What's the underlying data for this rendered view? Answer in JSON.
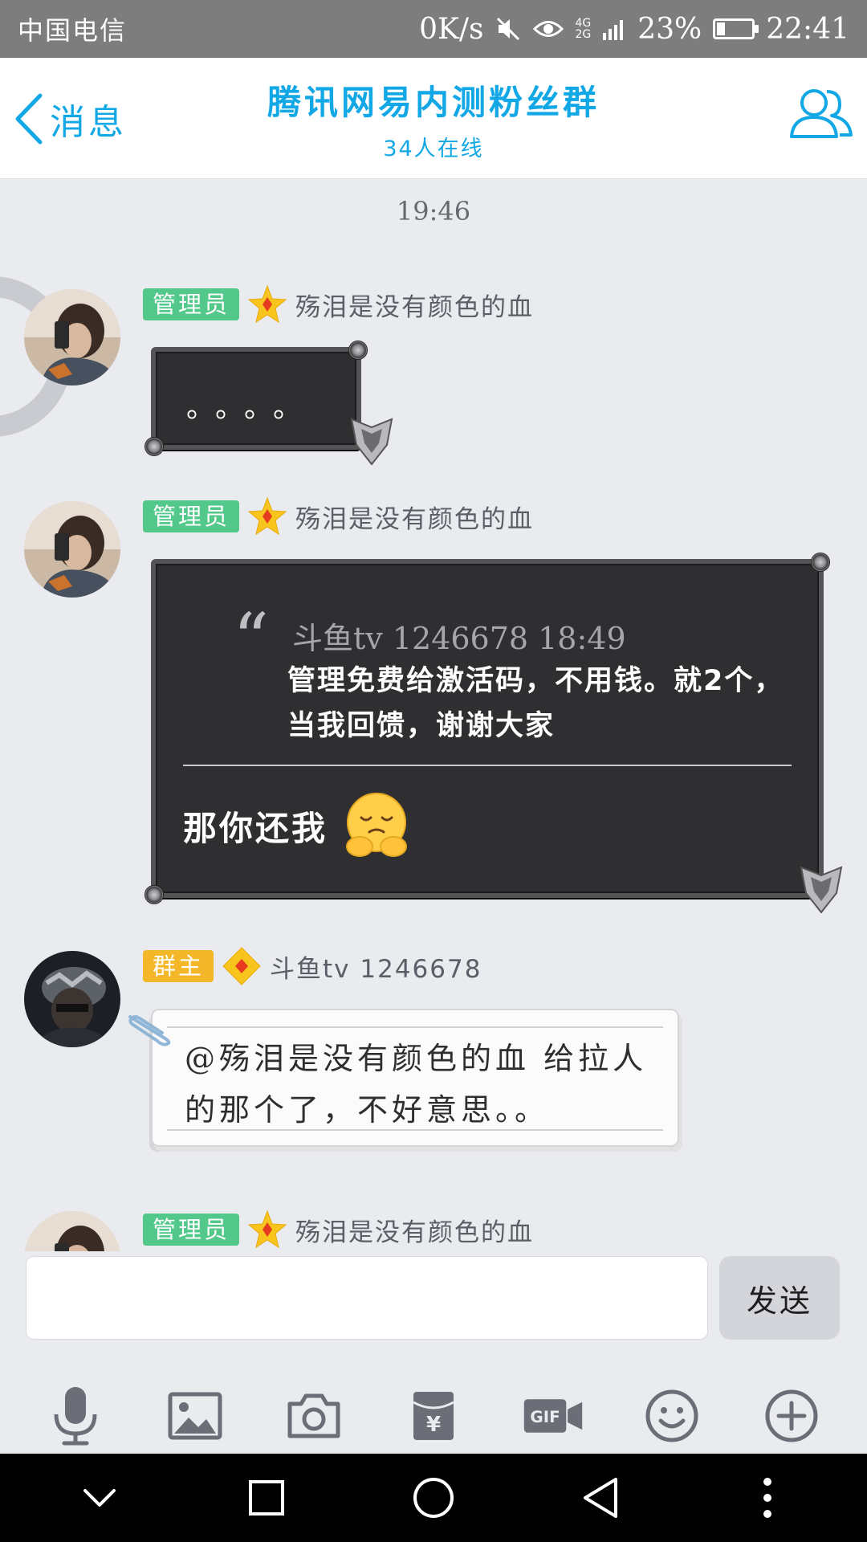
{
  "status_bar": {
    "carrier": "中国电信",
    "speed": "0K/s",
    "network_top": "4G",
    "network_bottom": "2G",
    "battery_level": "23%",
    "battery_fraction": 0.23,
    "time": "22:41"
  },
  "header": {
    "back_label": "消息",
    "title": "腾讯网易内测粉丝群",
    "subtitle": "34人在线",
    "members_icon": "members-icon"
  },
  "chat": {
    "timestamp": "19:46",
    "messages": [
      {
        "badge": "管理员",
        "sender": "殇泪是没有颜色的血",
        "text": "。。。。"
      },
      {
        "badge": "管理员",
        "sender": "殇泪是没有颜色的血",
        "quote_source": "斗鱼tv 1246678 18:49",
        "quote_text": "管理免费给激活码，不用钱。就2个，当我回馈，谢谢大家",
        "reply_text": "那你还我",
        "emoji": "hugging-face-emoji"
      },
      {
        "badge": "群主",
        "sender": "斗鱼tv 1246678",
        "text": "@殇泪是没有颜色的血 给拉人的那个了，不好意思。。"
      },
      {
        "badge": "管理员",
        "sender": "殇泪是没有颜色的血"
      }
    ]
  },
  "input": {
    "value": "",
    "placeholder": "",
    "send_label": "发送"
  },
  "toolbar": [
    "microphone-icon",
    "image-icon",
    "camera-icon",
    "red-packet-icon",
    "gif-icon",
    "emoji-icon",
    "plus-icon"
  ],
  "navbar": [
    "chevron-down-icon",
    "recents-icon",
    "home-icon",
    "back-icon",
    "more-icon"
  ],
  "colors": {
    "accent": "#12a8e6",
    "admin_badge": "#52c98a",
    "owner_badge": "#f4b72a",
    "dark_bubble": "#2f2f31"
  }
}
